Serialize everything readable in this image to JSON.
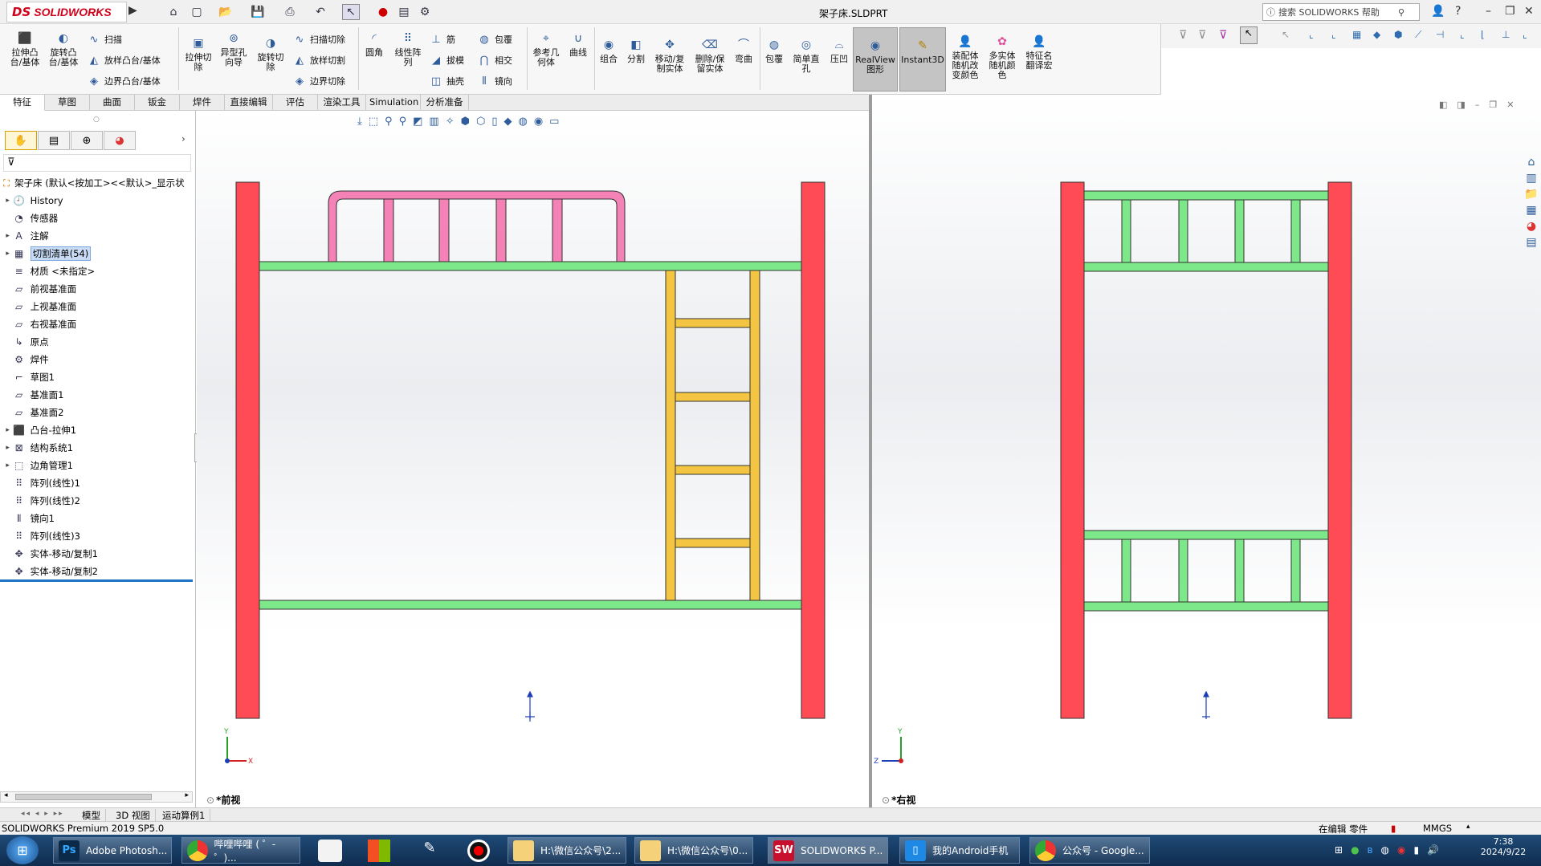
{
  "titlebar": {
    "logo_ds": "DS",
    "logo_sw": "SOLIDWORKS",
    "document_title": "架子床.SLDPRT",
    "search_placeholder": "搜索 SOLIDWORKS 帮助"
  },
  "commands": {
    "extrude_boss": "拉伸凸\n台/基体",
    "revolve_boss": "旋转凸\n台/基体",
    "sweep": "扫描",
    "loft": "放样凸台/基体",
    "boundary": "边界凸台/基体",
    "extrude_cut": "拉伸切\n除",
    "hole_wizard": "异型孔\n向导",
    "revolve_cut": "旋转切\n除",
    "sweep_cut": "扫描切除",
    "loft_cut": "放样切割",
    "boundary_cut": "边界切除",
    "fillet": "圆角",
    "linear_pattern": "线性阵\n列",
    "rib": "筋",
    "draft": "拔模",
    "shell": "抽壳",
    "wrap": "包覆",
    "intersect": "相交",
    "mirror": "镜向",
    "ref_geometry": "参考几\n何体",
    "curves": "曲线",
    "combine": "组合",
    "split": "分割",
    "move_copy": "移动/复\n制实体",
    "delete_keep": "删除/保\n留实体",
    "flex": "弯曲",
    "wrap2": "包覆",
    "simple_hole": "简单直\n孔",
    "indent": "压凹",
    "realview": "RealView\n图形",
    "instant3d": "Instant3D",
    "assembly_color": "装配体\n随机改\n变颜色",
    "multibody_color": "多实体\n随机颜\n色",
    "feature_translate": "特征名\n翻译宏"
  },
  "tabs": [
    "特征",
    "草图",
    "曲面",
    "钣金",
    "焊件",
    "直接编辑",
    "评估",
    "渲染工具",
    "Simulation",
    "分析准备"
  ],
  "tree": {
    "root": "架子床  (默认<按加工><<默认>_显示状",
    "items": [
      {
        "label": "History",
        "icon": "history-icon",
        "expand": true
      },
      {
        "label": "传感器",
        "icon": "sensor-icon",
        "expand": false
      },
      {
        "label": "注解",
        "icon": "annotation-icon",
        "expand": true
      },
      {
        "label": "切割清单(54)",
        "icon": "cutlist-icon",
        "expand": true,
        "selected": true
      },
      {
        "label": "材质 <未指定>",
        "icon": "material-icon",
        "expand": false
      },
      {
        "label": "前视基准面",
        "icon": "plane-icon",
        "expand": false
      },
      {
        "label": "上视基准面",
        "icon": "plane-icon",
        "expand": false
      },
      {
        "label": "右视基准面",
        "icon": "plane-icon",
        "expand": false
      },
      {
        "label": "原点",
        "icon": "origin-icon",
        "expand": false
      },
      {
        "label": "焊件",
        "icon": "weldment-icon",
        "expand": false
      },
      {
        "label": "草图1",
        "icon": "sketch-icon",
        "expand": false
      },
      {
        "label": "基准面1",
        "icon": "plane-icon",
        "expand": false
      },
      {
        "label": "基准面2",
        "icon": "plane-icon",
        "expand": false
      },
      {
        "label": "凸台-拉伸1",
        "icon": "extrude-icon",
        "expand": true
      },
      {
        "label": "结构系统1",
        "icon": "structure-icon",
        "expand": true
      },
      {
        "label": "边角管理1",
        "icon": "corner-icon",
        "expand": true
      },
      {
        "label": "阵列(线性)1",
        "icon": "pattern-icon",
        "expand": false
      },
      {
        "label": "阵列(线性)2",
        "icon": "pattern-icon",
        "expand": false
      },
      {
        "label": "镜向1",
        "icon": "mirror-icon",
        "expand": false
      },
      {
        "label": "阵列(线性)3",
        "icon": "pattern-icon",
        "expand": false
      },
      {
        "label": "实体-移动/复制1",
        "icon": "move-icon",
        "expand": false
      },
      {
        "label": "实体-移动/复制2",
        "icon": "move-icon",
        "expand": false
      }
    ]
  },
  "viewports": {
    "left_label": "*前视",
    "right_label": "*右视"
  },
  "bottom_tabs": [
    "模型",
    "3D 视图",
    "运动算例1"
  ],
  "status": {
    "product": "SOLIDWORKS Premium 2019 SP5.0",
    "mode": "在编辑 零件",
    "units": "MMGS"
  },
  "taskbar": {
    "items": [
      "Adobe Photosh...",
      "哔哩哔哩 ( ゜- ゜)...",
      "H:\\微信公众号\\2...",
      "H:\\微信公众号\\0...",
      "SOLIDWORKS P...",
      "我的Android手机",
      "公众号 - Google..."
    ],
    "time": "7:38",
    "date": "2024/9/22"
  },
  "colors": {
    "post": "#ff4b55",
    "rail": "#7de88a",
    "headboard": "#f582b6",
    "ladder": "#f4c542",
    "accent": "#1c6fb8"
  }
}
